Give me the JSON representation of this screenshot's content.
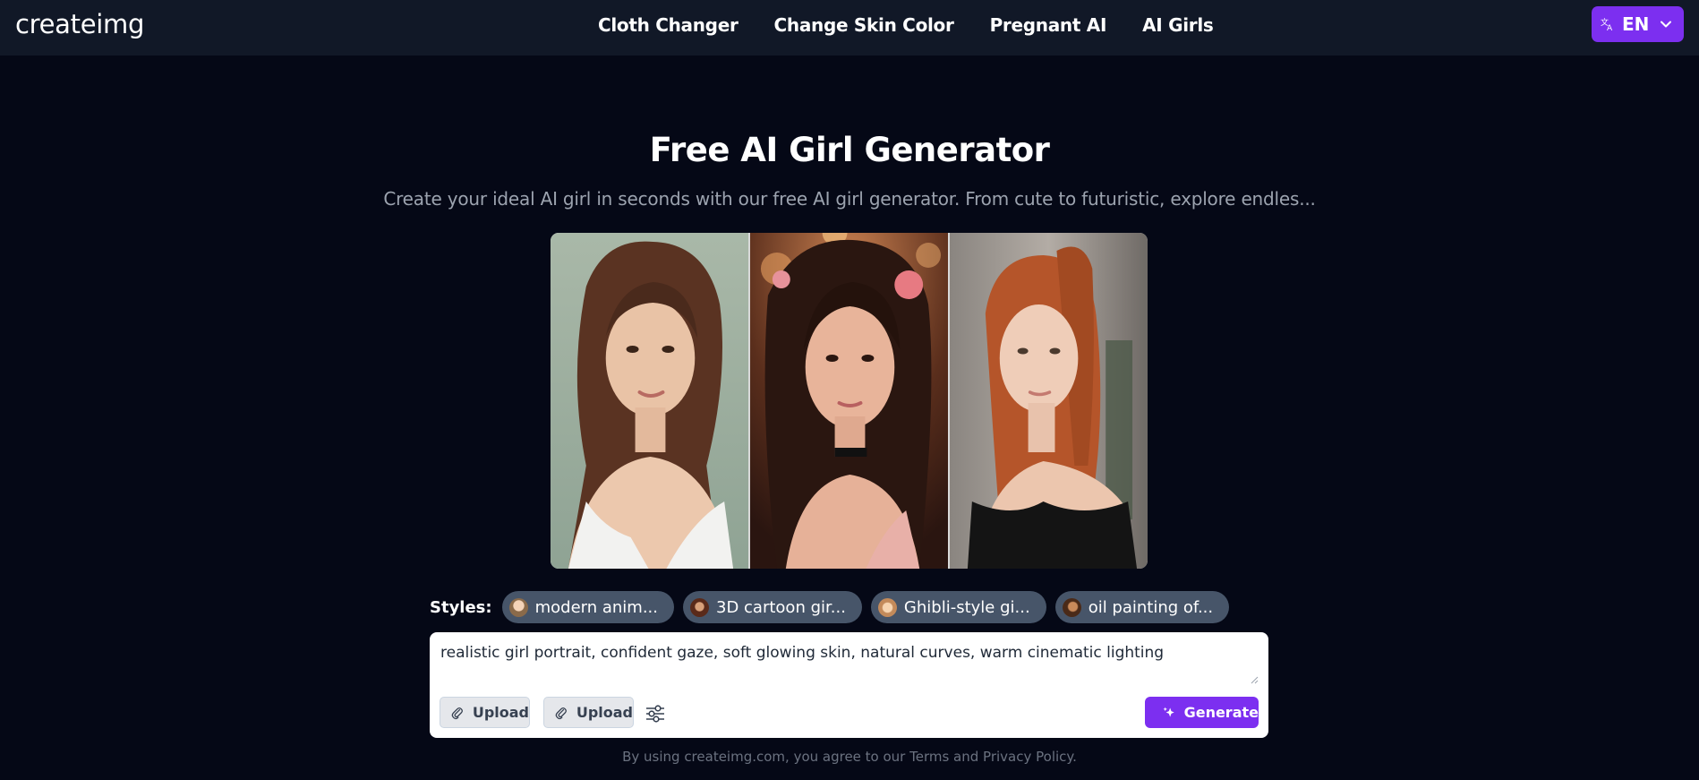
{
  "header": {
    "logo": "createimg",
    "nav": [
      "Cloth Changer",
      "Change Skin Color",
      "Pregnant AI",
      "AI Girls"
    ],
    "language": {
      "icon": "translate-icon",
      "label": "EN"
    }
  },
  "hero": {
    "title": "Free AI Girl Generator",
    "subtitle": "Create your ideal AI girl in seconds with our free AI girl generator. From cute to futuristic, explore endles..."
  },
  "gallery": {
    "images": [
      {
        "name": "portrait-1",
        "description_hidden": true
      },
      {
        "name": "portrait-2",
        "description_hidden": true
      },
      {
        "name": "portrait-3",
        "description_hidden": true
      }
    ]
  },
  "styles": {
    "label": "Styles:",
    "chips": [
      {
        "label": "modern anim...",
        "thumb_color": "#b08a6a"
      },
      {
        "label": "3D cartoon gir...",
        "thumb_color": "#6b3a2a"
      },
      {
        "label": "Ghibli-style gi...",
        "thumb_color": "#c9956a"
      },
      {
        "label": "oil painting of...",
        "thumb_color": "#7a4a2a"
      }
    ]
  },
  "prompt": {
    "value": "realistic girl portrait, confident gaze, soft glowing skin, natural curves, warm cinematic lighting",
    "upload_label_1": "Upload",
    "upload_label_2": "Upload",
    "generate_label": "Generate"
  },
  "footer": {
    "note": "By using createimg.com, you agree to our Terms and Privacy Policy."
  },
  "colors": {
    "accent": "#7c2ff0",
    "background": "#050816",
    "topbar": "#111827",
    "chip": "#475569"
  }
}
